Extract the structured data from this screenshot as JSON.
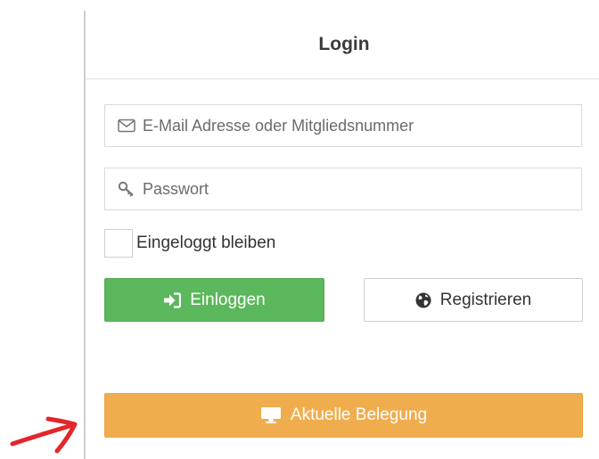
{
  "header": {
    "title": "Login"
  },
  "form": {
    "email": {
      "placeholder": "E-Mail Adresse oder Mitgliedsnummer",
      "value": ""
    },
    "password": {
      "placeholder": "Passwort",
      "value": ""
    },
    "remember": {
      "label": "Eingeloggt bleiben",
      "checked": false
    },
    "login_button": {
      "label": "Einloggen",
      "icon": "sign-in-icon",
      "color": "#5cb85c"
    },
    "register_button": {
      "label": "Registrieren",
      "icon": "globe-icon"
    },
    "occupancy_button": {
      "label": "Aktuelle Belegung",
      "icon": "monitor-icon",
      "color": "#f0ad4e"
    }
  },
  "annotation": {
    "icon": "red-arrow-annotation",
    "color": "#e3262b"
  }
}
